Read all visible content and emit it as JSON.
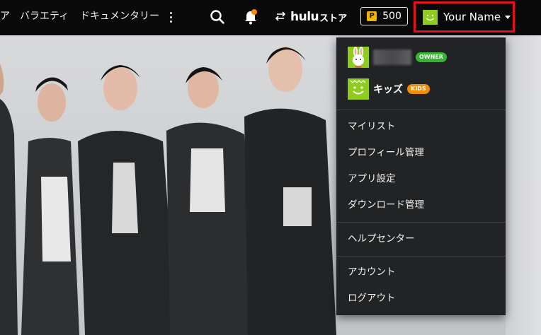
{
  "nav": {
    "links": [
      {
        "label": "ア"
      },
      {
        "label": "バラエティ"
      },
      {
        "label": "ドキュメンタリー"
      }
    ],
    "store_label_hulu": "hulu",
    "store_label_suffix": "ストア",
    "points": {
      "icon_letter": "P",
      "value": "500"
    },
    "profile_name": "Your Name"
  },
  "menu": {
    "profiles": [
      {
        "name": "",
        "badge": "OWNER",
        "icon": "rabbit-avatar-icon"
      },
      {
        "name": "キッズ",
        "badge": "KIDS",
        "icon": "kids-smile-avatar-icon"
      }
    ],
    "group1": [
      "マイリスト",
      "プロフィール管理",
      "アプリ設定",
      "ダウンロード管理"
    ],
    "group2": [
      "ヘルプセンター"
    ],
    "group3": [
      "アカウント",
      "ログアウト"
    ]
  },
  "colors": {
    "highlight_border": "#e11218",
    "owner_badge": "#35b52f",
    "kids_badge": "#f28c00",
    "notification_dot": "#ff8a00",
    "avatar_green": "#8fcc1d"
  }
}
